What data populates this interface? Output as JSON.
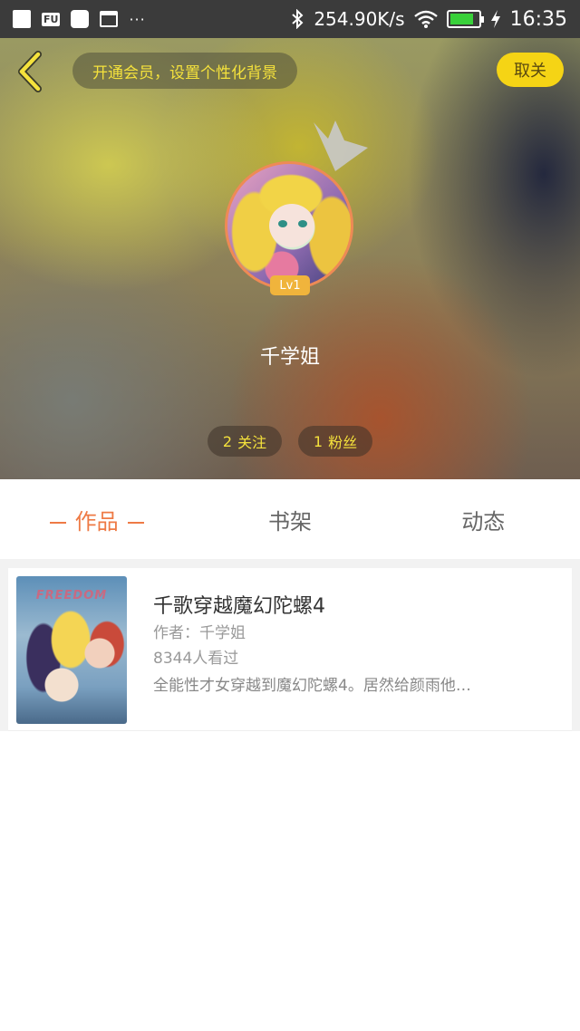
{
  "status_bar": {
    "notif_badge": "FU",
    "dots": "···",
    "net_speed": "254.90K/s",
    "battery_level": 0.85,
    "time": "16:35"
  },
  "header": {
    "vip_banner": "开通会员，设置个性化背景",
    "cancel_follow_label": "取关",
    "back_icon": "chevron-left-icon"
  },
  "profile": {
    "level": "Lv1",
    "username": "千学姐",
    "following_count": "2",
    "following_label": "关注",
    "fans_count": "1",
    "fans_label": "粉丝"
  },
  "tabs": [
    {
      "label": "作品",
      "active": true
    },
    {
      "label": "书架",
      "active": false
    },
    {
      "label": "动态",
      "active": false
    }
  ],
  "books": [
    {
      "cover_text": "FREEDOM",
      "title": "千歌穿越魔幻陀螺4",
      "author": "作者：千学姐",
      "views": "8344人看过",
      "description": "全能性才女穿越到魔幻陀螺4。居然给颜雨他…"
    }
  ],
  "colors": {
    "accent_orange": "#ee7a45",
    "accent_yellow": "#f5d415",
    "status_bar_bg": "#3b3b3b"
  }
}
